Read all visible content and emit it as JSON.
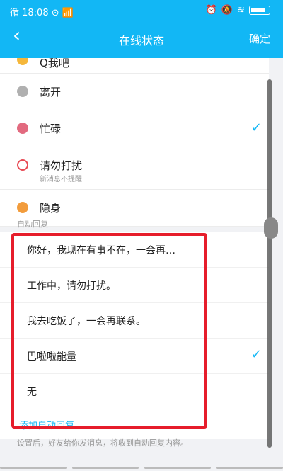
{
  "status_bar": {
    "left_text": "循 18:08 ⊙ 📶",
    "right_icons": [
      "alarm-icon",
      "mute-icon",
      "wifi-icon",
      "battery-icon"
    ]
  },
  "nav": {
    "back_icon": "‹",
    "title": "在线状态",
    "confirm": "确定"
  },
  "statuses": [
    {
      "label": "Q我吧",
      "color": "#f5b73b",
      "partial": true
    },
    {
      "label": "离开",
      "color": "#b0b0b0"
    },
    {
      "label": "忙碌",
      "color": "#e26a7f",
      "selected": true
    },
    {
      "label": "请勿打扰",
      "sub": "新消息不提醒",
      "color": "#e84b55",
      "icon": "no-disturb-icon"
    },
    {
      "label": "隐身",
      "color": "#f29c3c"
    }
  ],
  "auto_reply": {
    "section_title": "自动回复",
    "replies": [
      {
        "text": "你好，我现在有事不在，一会再…"
      },
      {
        "text": "工作中，请勿打扰。"
      },
      {
        "text": "我去吃饭了，一会再联系。"
      },
      {
        "text": "巴啦啦能量",
        "selected": true
      },
      {
        "text": "无"
      }
    ],
    "add_label": "添加自动回复"
  },
  "footer": "设置后，好友给你发消息，将收到自动回复内容。",
  "colors": {
    "accent": "#12b7f5",
    "highlight": "#e61d2b"
  }
}
